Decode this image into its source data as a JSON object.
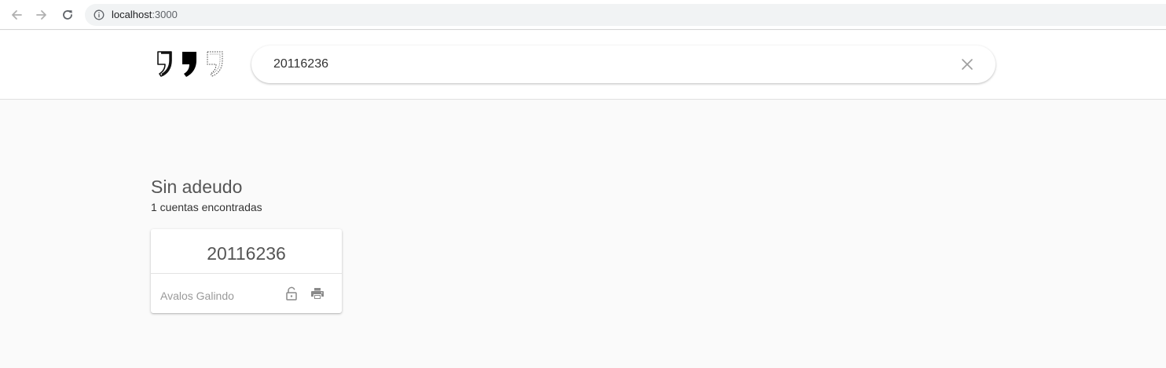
{
  "browser": {
    "url_host": "localhost",
    "url_port": ":3000"
  },
  "header": {
    "logo_icons": [
      "quote-outline-icon",
      "quote-filled-icon",
      "quote-dotted-icon"
    ],
    "search": {
      "value": "20116236",
      "clear_icon": "close-icon"
    }
  },
  "results": {
    "title": "Sin adeudo",
    "count_text": "1 cuentas encontradas",
    "accounts": [
      {
        "number": "20116236",
        "name": "Avalos Galindo",
        "actions": [
          "unlock-icon",
          "print-icon"
        ]
      }
    ]
  },
  "colors": {
    "page_background": "#fafafa",
    "card_background": "#ffffff",
    "muted_text": "#9a9a9a",
    "heading_text": "#555555"
  }
}
